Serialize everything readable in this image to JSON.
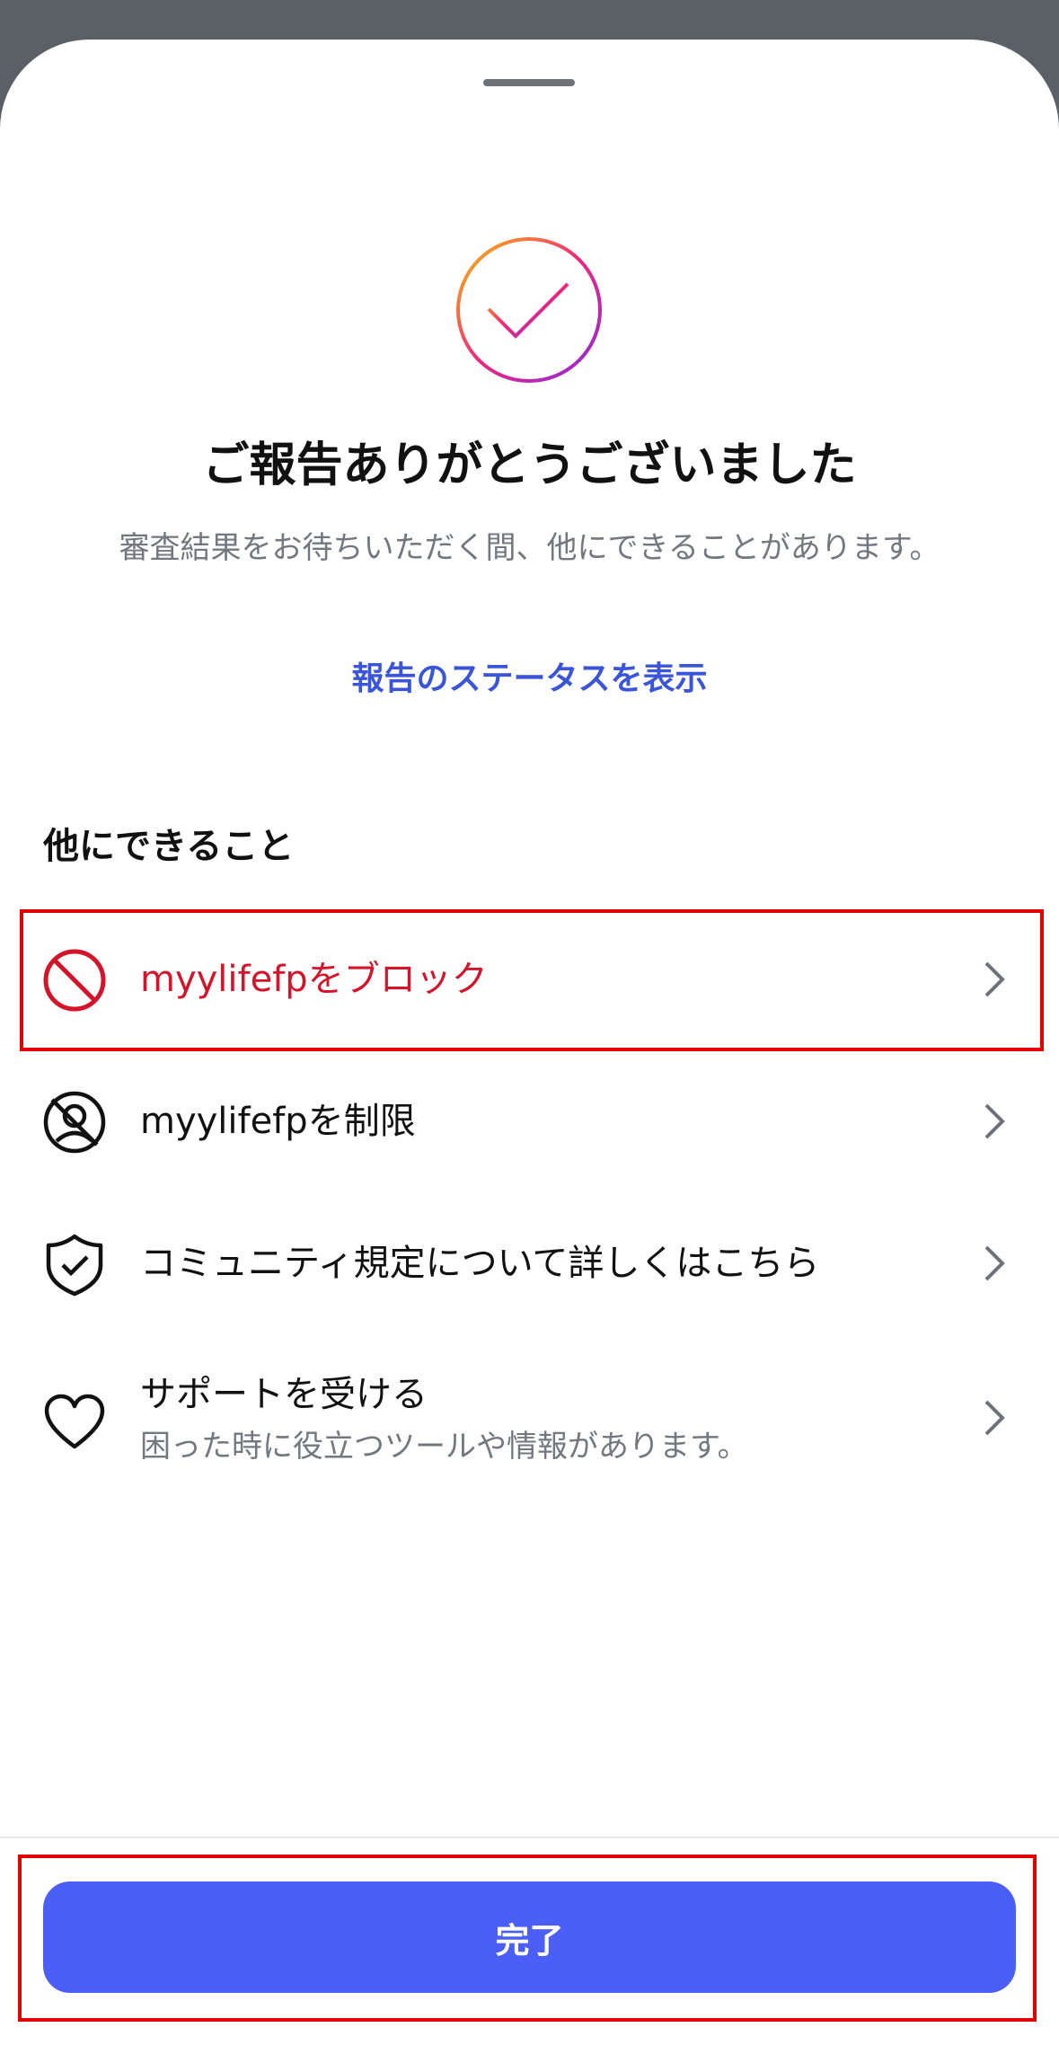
{
  "sheet": {
    "title": "ご報告ありがとうございました",
    "subtitle": "審査結果をお待ちいただく間、他にできることがあります。",
    "status_link": "報告のステータスを表示"
  },
  "section": {
    "title": "他にできること",
    "items": [
      {
        "label": "myylifefpをブロック",
        "icon": "block-icon",
        "color": "#d4142a"
      },
      {
        "label": "myylifefpを制限",
        "icon": "restrict-icon"
      },
      {
        "label": "コミュニティ規定について詳しくはこちら",
        "icon": "shield-check-icon"
      },
      {
        "label": "サポートを受ける",
        "sublabel": "困った時に役立つツールや情報があります。",
        "icon": "heart-icon"
      }
    ]
  },
  "footer": {
    "done_label": "完了"
  },
  "colors": {
    "accent": "#4b5ff7",
    "link": "#3b55d9",
    "danger": "#d4142a",
    "highlight": "#e00000"
  }
}
